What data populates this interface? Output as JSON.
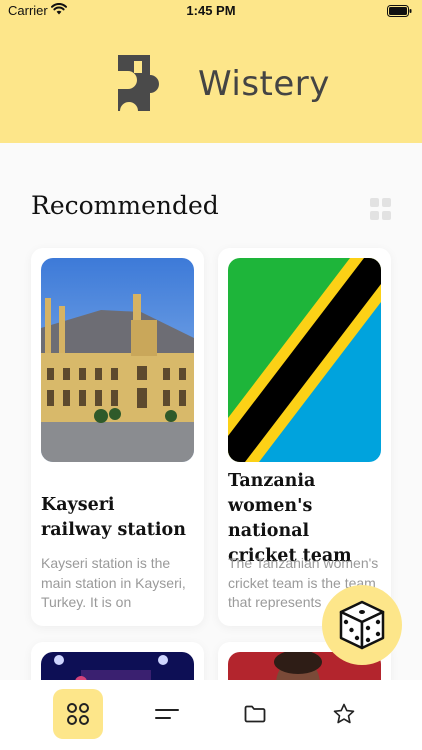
{
  "status": {
    "carrier": "Carrier",
    "time": "1:45 PM"
  },
  "app": {
    "title": "Wistery"
  },
  "section": {
    "title": "Recommended"
  },
  "cards": [
    {
      "title": "Kayseri railway station",
      "description": "Kayseri station is the main station in Kayseri, Turkey. It is on Kocasinan Boulevard.",
      "image": "railway-station-photo"
    },
    {
      "title": "Tanzania women's national cricket team",
      "description": "The Tanzanian women's cricket team is the team that represents Tanzania.",
      "image": "tanzania-flag"
    }
  ],
  "tabbar": {
    "items": [
      "grid-icon",
      "list-icon",
      "folder-icon",
      "star-icon"
    ],
    "active": 0
  },
  "colors": {
    "accent": "#fde68a",
    "background": "#fafafa"
  }
}
